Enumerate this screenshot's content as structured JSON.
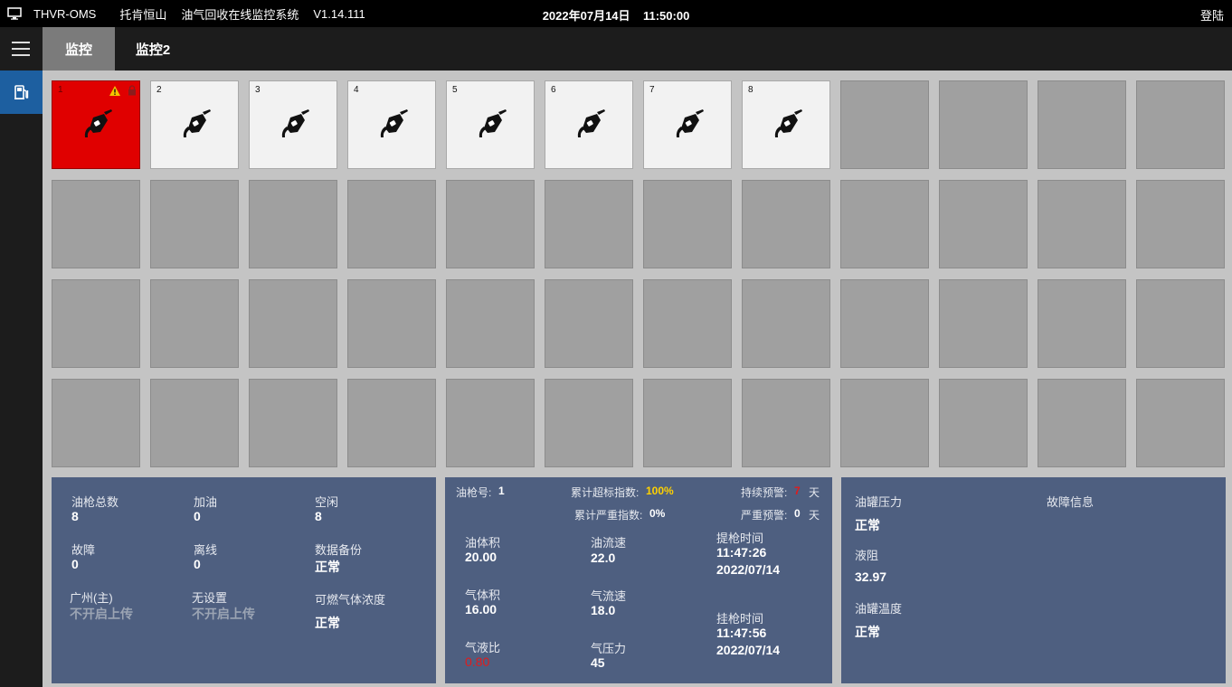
{
  "titlebar": {
    "app_name": "THVR-OMS",
    "site": "托肯恒山",
    "system_name": "油气回收在线监控系统",
    "version": "V1.14.111",
    "datetime": "2022年07月14日    11:50:00",
    "login": "登陆"
  },
  "tabs": [
    {
      "label": "监控",
      "active": true
    },
    {
      "label": "监控2",
      "active": false
    }
  ],
  "nozzles": [
    {
      "number": "1",
      "status": "alarm",
      "icon": "nozzle-icon",
      "warning_icon": "warning-triangle-icon",
      "lock_icon": "lock-icon"
    },
    {
      "number": "2",
      "status": "on",
      "icon": "nozzle-icon"
    },
    {
      "number": "3",
      "status": "on",
      "icon": "nozzle-icon"
    },
    {
      "number": "4",
      "status": "on",
      "icon": "nozzle-icon"
    },
    {
      "number": "5",
      "status": "on",
      "icon": "nozzle-icon"
    },
    {
      "number": "6",
      "status": "on",
      "icon": "nozzle-icon"
    },
    {
      "number": "7",
      "status": "on",
      "icon": "nozzle-icon"
    },
    {
      "number": "8",
      "status": "on",
      "icon": "nozzle-icon"
    }
  ],
  "summary": {
    "total_label": "油枪总数",
    "total": "8",
    "fueling_label": "加油",
    "fueling": "0",
    "idle_label": "空闲",
    "idle": "8",
    "fault_label": "故障",
    "fault": "0",
    "offline_label": "离线",
    "offline": "0",
    "backup_label": "数据备份",
    "backup": "正常",
    "upload1_label": "广州(主)",
    "upload1": "不开启上传",
    "upload2_label": "无设置",
    "upload2": "不开启上传",
    "gas_label": "可燃气体浓度",
    "gas": "正常"
  },
  "detail": {
    "nozzle_no_label": "油枪号:",
    "nozzle_no": "1",
    "over_index_label": "累计超标指数:",
    "over_index": "100%",
    "continuous_warn_label": "持续预警:",
    "continuous_warn": "7",
    "continuous_unit": "天",
    "severe_index_label": "累计严重指数:",
    "severe_index": "0%",
    "severe_warn_label": "严重预警:",
    "severe_warn": "0",
    "severe_unit": "天",
    "oil_volume_label": "油体积",
    "oil_volume": "20.00",
    "oil_flow_label": "油流速",
    "oil_flow": "22.0",
    "lift_time_label": "提枪时间",
    "lift_time": "11:47:26",
    "lift_date": "2022/07/14",
    "gas_volume_label": "气体积",
    "gas_volume": "16.00",
    "gas_flow_label": "气流速",
    "gas_flow": "18.0",
    "hang_time_label": "挂枪时间",
    "hang_time": "11:47:56",
    "hang_date": "2022/07/14",
    "ratio_label": "气液比",
    "ratio": "0.80",
    "gas_pressure_label": "气压力",
    "gas_pressure": "45"
  },
  "tank": {
    "pressure_label": "油罐压力",
    "pressure": "正常",
    "fault_info_label": "故障信息",
    "resistance_label": "液阻",
    "resistance": "32.97",
    "temperature_label": "油罐温度",
    "temperature": "正常"
  },
  "colors": {
    "alarm": "#e00000",
    "panel": "#4e5f80",
    "accent_blue": "#1d5fa0",
    "warning_red": "#e21b1b",
    "warning_yellow": "#ffd100"
  }
}
